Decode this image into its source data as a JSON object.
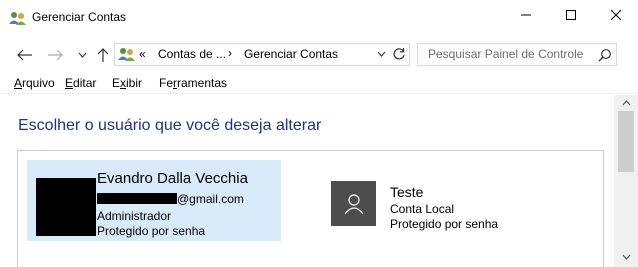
{
  "window": {
    "title": "Gerenciar Contas",
    "icon": "users-control-panel-icon"
  },
  "address": {
    "overflow": "«",
    "crumbs": [
      "Contas de ...",
      "Gerenciar Contas"
    ],
    "separator": "›"
  },
  "search": {
    "placeholder": "Pesquisar Painel de Controle"
  },
  "menu": {
    "items": [
      {
        "label": "Arquivo",
        "accel": "A",
        "rest": "rquivo"
      },
      {
        "label": "Editar",
        "accel": "E",
        "rest": "ditar"
      },
      {
        "label": "Exibir",
        "accel_pre": "E",
        "accel": "x",
        "rest": "ibir"
      },
      {
        "label": "Ferramentas",
        "accel_pre": "Fe",
        "accel": "r",
        "rest": "ramentas"
      }
    ]
  },
  "main": {
    "title": "Escolher o usuário que você deseja alterar"
  },
  "accounts": [
    {
      "name": "Evandro Dalla Vecchia",
      "email_suffix": "@gmail.com",
      "role": "Administrador",
      "protection": "Protegido por senha",
      "selected": true
    },
    {
      "name": "Teste",
      "type": "Conta Local",
      "protection": "Protegido por senha",
      "selected": false
    }
  ],
  "colors": {
    "title_blue": "#1e3287",
    "selected_bg": "#d7ebfb",
    "generic_avatar": "#4d4d4d"
  }
}
